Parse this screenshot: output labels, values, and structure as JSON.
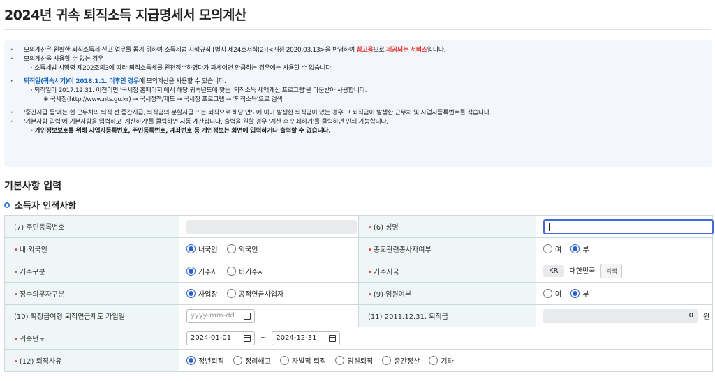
{
  "page": {
    "title": "2024년 귀속 퇴직소득 지급명세서 모의계산"
  },
  "notice": {
    "l1a": "모의계산은 원활한 퇴직소득세 신고 업무를 돕기 위하여 소득세법 시행규칙 [별지 제24호서식(2)]<개정 2020.03.13>을 반영하여 ",
    "l1b": "참고용",
    "l1c": "으로 ",
    "l1d": "제공되는 서비스",
    "l1e": "입니다.",
    "l2": "모의계산을 사용할 수 없는 경우",
    "l3": "· 소득세법 시행령 제202조의3에 따라 퇴직소득세를 원천징수하였다가 과세이연 환급하는 경우에는 사용할 수 없습니다.",
    "l4a": "퇴직일(귀속시기)이 2018.1.1. 이후인 경우",
    "l4b": "에 모의계산을 사용할 수 있습니다.",
    "l5": "· 퇴직일이 2017.12.31. 이전이면 '국세청 홈페이지'에서 해당 귀속년도에 맞는 '퇴직소득 세액계산 프로그램'을 다운받아 사용합니다.",
    "l6": "※ 국세청(http://www.nts.go.kr) → 국세정책/제도 → 국세청 프로그램 → '퇴직소득'으로 검색",
    "l7": "'중간지급 등'에는 현 근무처의 퇴직 전 중간지급, 퇴직금의 분할지급 또는 퇴직으로 해당 연도에 이미 발생한 퇴직금이 있는 경우 그 퇴직금이 발생한 근무처 및 사업자등록번호를 적습니다.",
    "l8": "'기본사항 입력'에 기본사항을 입력하고 '계산하기'를 클릭하면 자동 계산됩니다. 출력을 원할 경우 '계산 후 인쇄하기'를 클릭하면 인쇄 가능합니다.",
    "l9": "· 개인정보보호를 위해 사업자등록번호, 주민등록번호, 계좌번호 등 개인정보는 화면에 입력하거나 출력할 수 없습니다."
  },
  "section": {
    "title": "기본사항 입력",
    "subtitle": "소득자 인적사항"
  },
  "form": {
    "resident_no": "(7) 주민등록번호",
    "name": "(6) 성명",
    "nationality": "내·외국인",
    "nationality_opt1": "내국인",
    "nationality_opt2": "외국인",
    "religion": "종교관련종사자여부",
    "yes": "여",
    "no": "부",
    "residence": "거주구분",
    "residence_opt1": "거주자",
    "residence_opt2": "비거주자",
    "residence_region": "거주지국",
    "region_code": "KR",
    "region_name": "대한민국",
    "search": "검색",
    "withholder": "징수의무자구분",
    "withholder_opt1": "사업장",
    "withholder_opt2": "공적연금사업자",
    "executive": "(9) 임원여부",
    "pension_join": "(10) 확정급여형 퇴직연금제도 가입일",
    "date_placeholder": "yyyy-mm-dd",
    "severance_2011": "(11) 2011.12.31. 퇴직금",
    "severance_amount": "0",
    "unit_won": "원",
    "attribution_year": "귀속년도",
    "year_start": "2024-01-01",
    "tilde": "~",
    "year_end": "2024-12-31",
    "reason": "(12) 퇴직사유",
    "reasons": [
      "정년퇴직",
      "정리해고",
      "자발적 퇴직",
      "임원퇴직",
      "중간정산",
      "기타"
    ]
  }
}
